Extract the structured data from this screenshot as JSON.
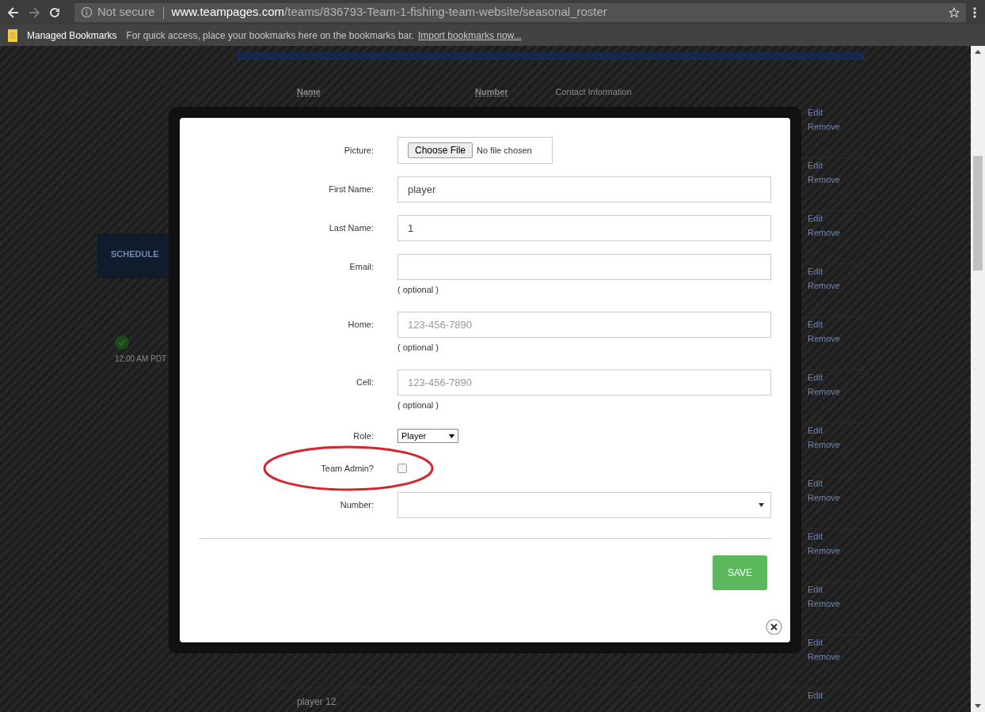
{
  "browser": {
    "security": "Not secure",
    "url_host": "www.teampages.com",
    "url_path": "/teams/836793-Team-1-fishing-team-website/seasonal_roster",
    "bookmarks_folder": "Managed Bookmarks",
    "bookmarks_hint": "For quick access, place your bookmarks here on the bookmarks bar.",
    "bookmarks_link": "Import bookmarks now..."
  },
  "background": {
    "schedule_title": "SCHEDULE",
    "event_time": "12:00 AM PDT",
    "columns": [
      "Name",
      "Number",
      "Contact Information"
    ],
    "rows": [
      {
        "actions": [
          "Edit",
          "Remove"
        ]
      },
      {
        "actions": [
          "Edit",
          "Remove"
        ]
      },
      {
        "actions": [
          "Edit",
          "Remove"
        ]
      },
      {
        "actions": [
          "Edit",
          "Remove"
        ]
      },
      {
        "actions": [
          "Edit",
          "Remove"
        ]
      },
      {
        "actions": [
          "Edit",
          "Remove"
        ]
      },
      {
        "actions": [
          "Edit",
          "Remove"
        ]
      },
      {
        "actions": [
          "Edit",
          "Remove"
        ]
      },
      {
        "actions": [
          "Edit",
          "Remove"
        ]
      },
      {
        "actions": [
          "Edit",
          "Remove"
        ]
      },
      {
        "actions": [
          "Edit",
          "Remove"
        ]
      },
      {
        "name": "player 12",
        "actions": [
          "Edit"
        ]
      }
    ]
  },
  "modal": {
    "fields": [
      {
        "kind": "file",
        "label": "Picture:",
        "button": "Choose File",
        "value": "No file chosen"
      },
      {
        "kind": "text",
        "label": "First Name:",
        "value": "player"
      },
      {
        "kind": "text",
        "label": "Last Name:",
        "value": "1"
      },
      {
        "kind": "text",
        "label": "Email:",
        "hint": "( optional )"
      },
      {
        "kind": "text",
        "label": "Home:",
        "placeholder": "123-456-7890",
        "hint": "( optional )"
      },
      {
        "kind": "text",
        "label": "Cell:",
        "placeholder": "123-456-7890",
        "hint": "( optional )"
      },
      {
        "kind": "select",
        "label": "Role:",
        "value": "Player"
      },
      {
        "kind": "checkbox",
        "label": "Team Admin?",
        "checked": false,
        "circled": true
      },
      {
        "kind": "wide-select",
        "label": "Number:"
      }
    ],
    "save": "SAVE"
  }
}
